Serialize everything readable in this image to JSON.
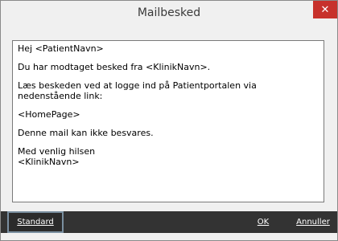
{
  "window": {
    "title": "Mailbesked",
    "close_glyph": "✕"
  },
  "editor": {
    "lines": [
      "Hej <PatientNavn>",
      "",
      "Du har modtaget besked fra <KlinikNavn>.",
      "",
      "Læs beskeden ved at logge ind på Patientportalen via",
      "nedenstående link:",
      "",
      "<HomePage>",
      "",
      "Denne mail kan ikke besvares.",
      "",
      "Med venlig hilsen",
      "<KlinikNavn>"
    ]
  },
  "buttons": {
    "standard": "Standard",
    "ok": "OK",
    "cancel": "Annuller"
  },
  "colors": {
    "close_button": "#c7312b",
    "bottom_bar": "#333333"
  }
}
